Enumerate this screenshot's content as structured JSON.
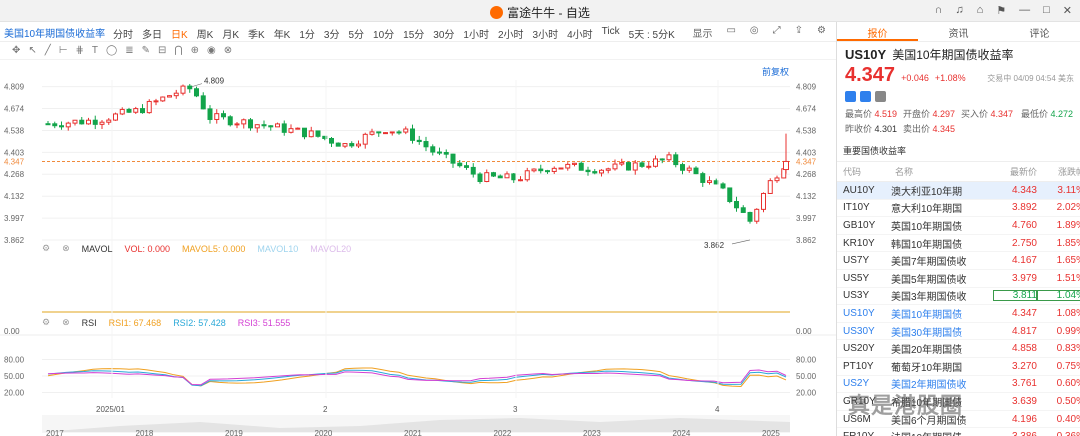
{
  "window": {
    "title": "富途牛牛 - 自选"
  },
  "toolbar": {
    "symbol_tab": "美国10年期国债收益率",
    "periods": [
      "分时",
      "多日",
      "日K",
      "周K",
      "月K",
      "季K",
      "年K",
      "1分",
      "3分",
      "5分",
      "10分",
      "15分",
      "30分",
      "1小时",
      "2小时",
      "3小时",
      "4小时",
      "Tick",
      "5天 : 5分K"
    ],
    "active_period": "日K",
    "display_label": "显示"
  },
  "chart_area": {
    "restore_label": "前复权",
    "high_label": "4.809",
    "low_label": "3.862",
    "current_label": "4.347",
    "y_ticks": [
      "4.809",
      "4.674",
      "4.538",
      "4.403",
      "4.268",
      "4.132",
      "3.997",
      "3.862"
    ],
    "x_labels": [
      "2025/01",
      "2",
      "3",
      "4"
    ],
    "nav_years": [
      "2017",
      "2018",
      "2019",
      "2020",
      "2021",
      "2022",
      "2023",
      "2024",
      "2025"
    ],
    "mavol": {
      "title": "MAVOL",
      "vol": "VOL: 0.000",
      "mavol5": "MAVOL5: 0.000",
      "mavol10": "MAVOL10",
      "mavol20": "MAVOL20",
      "zero": "0.00"
    },
    "rsi": {
      "title": "RSI",
      "rsi1": "RSI1: 67.468",
      "rsi2": "RSI2: 57.428",
      "rsi3": "RSI3: 51.555",
      "ticks": [
        "80.00",
        "50.00",
        "20.00"
      ]
    }
  },
  "quote": {
    "tabs": [
      "报价",
      "资讯",
      "评论"
    ],
    "code": "US10Y",
    "name": "美国10年期国债收益率",
    "price": "4.347",
    "change": "+0.046",
    "change_pct": "+1.08%",
    "time": "交易中 04/09 04:54 美东",
    "stats": [
      [
        "最高价",
        "4.519"
      ],
      [
        "开盘价",
        "4.297"
      ],
      [
        "买入价",
        "4.347"
      ],
      [
        "最低价",
        "4.272"
      ],
      [
        "昨收价",
        "4.301"
      ],
      [
        "卖出价",
        "4.345"
      ]
    ],
    "section_title": "重要国债收益率",
    "table_headers": [
      "代码",
      "名称",
      "最新价",
      "涨跌幅"
    ],
    "rows": [
      [
        "AU10Y",
        "澳大利亚10年期",
        "4.343",
        "3.11%"
      ],
      [
        "IT10Y",
        "意大利10年期国",
        "3.892",
        "2.02%"
      ],
      [
        "GB10Y",
        "英国10年期国债",
        "4.760",
        "1.89%"
      ],
      [
        "KR10Y",
        "韩国10年期国债",
        "2.750",
        "1.85%"
      ],
      [
        "US7Y",
        "美国7年期国债收",
        "4.167",
        "1.65%"
      ],
      [
        "US5Y",
        "美国5年期国债收",
        "3.979",
        "1.51%"
      ],
      [
        "US3Y",
        "美国3年期国债收",
        "3.811",
        "1.04%"
      ],
      [
        "US10Y",
        "美国10年期国债",
        "4.347",
        "1.08%"
      ],
      [
        "US30Y",
        "美国30年期国债",
        "4.817",
        "0.99%"
      ],
      [
        "US20Y",
        "美国20年期国债",
        "4.858",
        "0.83%"
      ],
      [
        "PT10Y",
        "葡萄牙10年期国",
        "3.270",
        "0.75%"
      ],
      [
        "US2Y",
        "美国2年期国债收",
        "3.761",
        "0.60%"
      ],
      [
        "GR10Y",
        "希腊10年期国债",
        "3.639",
        "0.50%"
      ],
      [
        "US6M",
        "美国6个月期国债",
        "4.196",
        "0.40%"
      ],
      [
        "FR10Y",
        "法国10年期国债",
        "3.386",
        "0.36%"
      ]
    ]
  },
  "watermark": "真是港股圈",
  "colors": {
    "up": "#e8312f",
    "down": "#13a44b",
    "accent": "#ff6a00",
    "link": "#2f80ed"
  }
}
